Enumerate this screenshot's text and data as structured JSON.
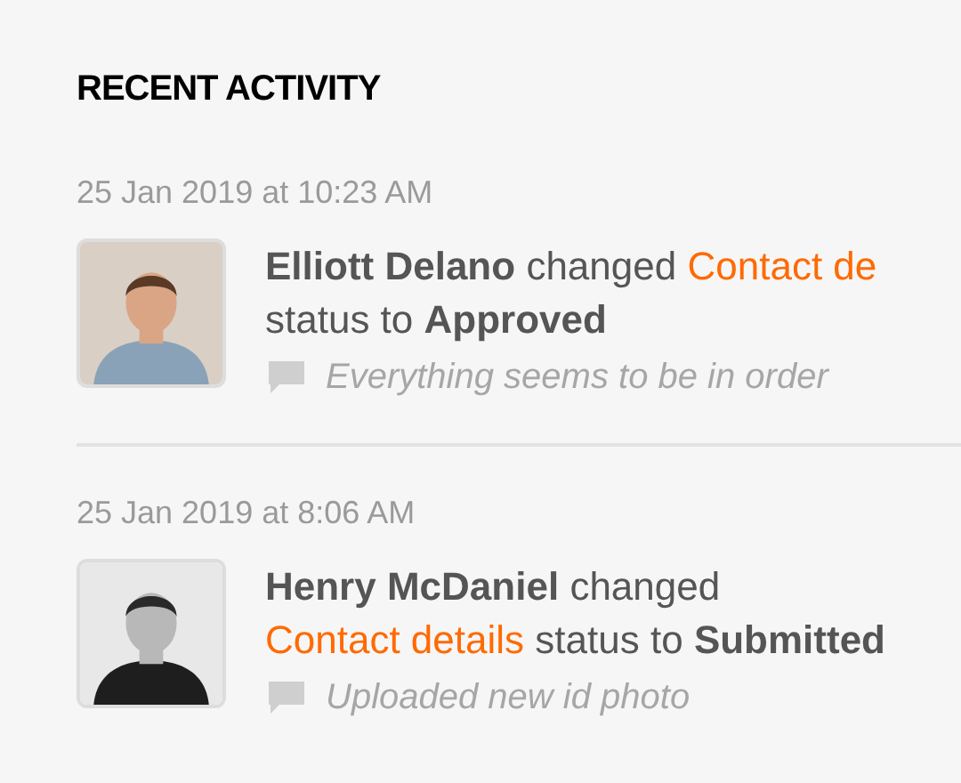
{
  "title": "RECENT ACTIVITY",
  "activities": [
    {
      "timestamp": "25 Jan 2019 at 10:23 AM",
      "actor": "Elliott Delano",
      "action": "changed",
      "link": "Contact de",
      "middle": "status to",
      "status": "Approved",
      "comment": "Everything seems to be in order"
    },
    {
      "timestamp": "25 Jan 2019 at 8:06 AM",
      "actor": "Henry McDaniel",
      "action": "changed",
      "link": "Contact details",
      "middle": "status to",
      "status": "Submitted",
      "comment": "Uploaded new id photo"
    }
  ]
}
